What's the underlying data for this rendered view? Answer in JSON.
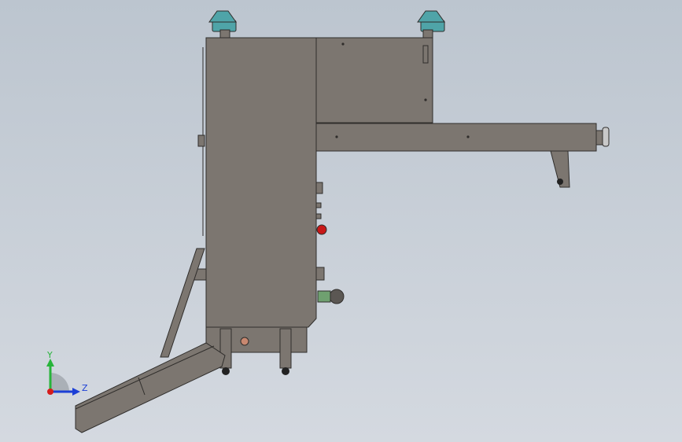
{
  "viewport": {
    "background_top": "#bcc5cf",
    "background_bottom": "#d4d9e0"
  },
  "triad": {
    "y_label": "Y",
    "z_label": "Z",
    "y_color": "#27b43a",
    "z_color": "#1c3fd6",
    "x_color": "#d61c1c"
  },
  "model": {
    "body_color": "#7c7670",
    "body_edge": "#2f2d2b",
    "foot_color": "#4fa4a8",
    "button_color": "#c81818"
  }
}
